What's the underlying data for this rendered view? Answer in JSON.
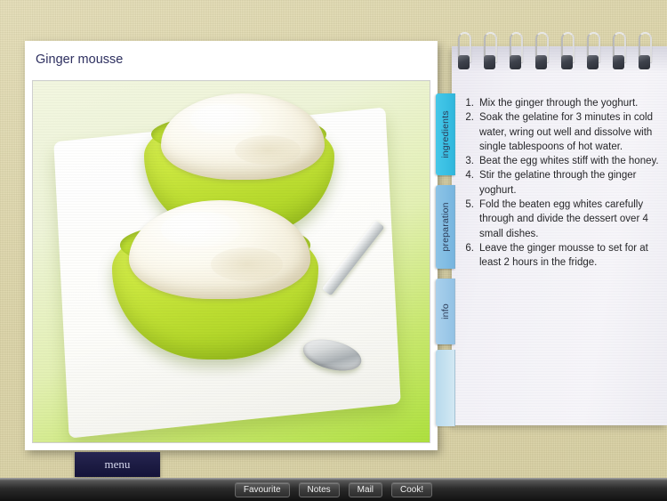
{
  "app": {
    "background_color": "#e0d9b0"
  },
  "card": {
    "title": "Ginger mousse",
    "photo": {
      "alt": "Two lime-green bowls of creamy ginger mousse on a white square plate with a silver spoon",
      "bowl_color": "#c9e63c",
      "mousse_color": "#fdfbf1",
      "plate_color": "#ffffff",
      "backdrop_color": "#aee03e"
    }
  },
  "tabs": [
    {
      "label": "ingredients",
      "color": "#39bfe3",
      "active": true
    },
    {
      "label": "preparation",
      "color": "#80bce3",
      "active": false
    },
    {
      "label": "info",
      "color": "#9cc8e8",
      "active": false
    }
  ],
  "notepad": {
    "spiral_ring_count": 8,
    "steps": [
      {
        "number": "1.",
        "text": "Mix the ginger through the yoghurt."
      },
      {
        "number": "2.",
        "text": "Soak the gelatine for 3 minutes in cold water, wring out well and dissolve with single tablespoons of hot water."
      },
      {
        "number": "3.",
        "text": "Beat the egg whites stiff with the honey."
      },
      {
        "number": "4.",
        "text": "Stir the gelatine through the ginger yoghurt."
      },
      {
        "number": "5.",
        "text": "Fold the beaten egg whites carefully through and divide the dessert over 4 small dishes."
      },
      {
        "number": "6.",
        "text": "Leave the ginger mousse to set for at least 2 hours in the fridge."
      }
    ]
  },
  "menu_button": {
    "label": "menu",
    "color": "#1c1b42"
  },
  "toolbar": {
    "buttons": [
      {
        "label": "Favourite"
      },
      {
        "label": "Notes"
      },
      {
        "label": "Mail"
      },
      {
        "label": "Cook!"
      }
    ]
  }
}
